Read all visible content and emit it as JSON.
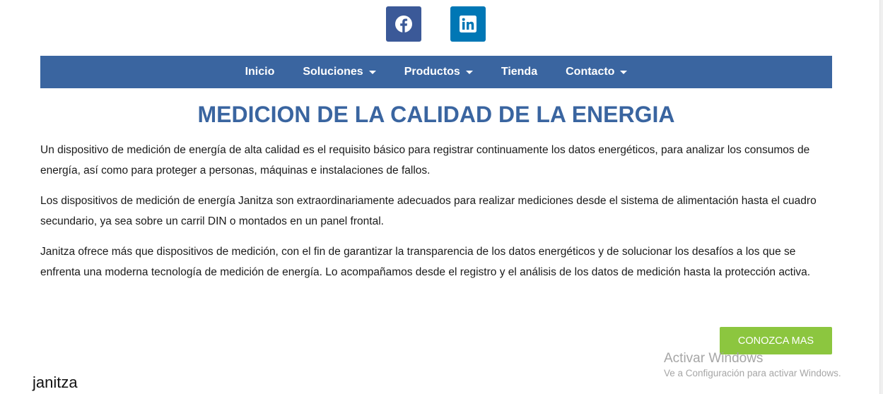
{
  "social": {
    "facebook_icon": "facebook-icon",
    "linkedin_icon": "linkedin-icon",
    "facebook_color": "#3b5998",
    "linkedin_color": "#0077b5"
  },
  "nav": {
    "background_color": "#3a65a0",
    "items": [
      {
        "label": "Inicio",
        "has_dropdown": false
      },
      {
        "label": "Soluciones",
        "has_dropdown": true
      },
      {
        "label": "Productos",
        "has_dropdown": true
      },
      {
        "label": "Tienda",
        "has_dropdown": false
      },
      {
        "label": "Contacto",
        "has_dropdown": true
      }
    ]
  },
  "main": {
    "title": "MEDICION DE LA CALIDAD DE LA ENERGIA",
    "title_color": "#3a65a0",
    "paragraphs": [
      "Un dispositivo de medición de energía de alta calidad es el requisito básico para registrar continuamente los datos energéticos, para analizar los consumos de energía, así como para proteger a personas, máquinas e instalaciones de fallos.",
      "Los dispositivos de medición de energía Janitza son extraordinariamente adecuados para realizar mediciones desde el sistema de alimentación hasta el cuadro secundario, ya sea sobre un carril DIN o montados en un panel frontal.",
      "Janitza ofrece más que dispositivos de medición, con el fin de garantizar la transparencia de los datos energéticos y de solucionar los desafíos a los que se enfrenta una moderna tecnología de medición de energía. Lo acompañamos desde el registro y el análisis de los datos de medición hasta la protección activa."
    ],
    "cta_label": "CONOZCA MAS",
    "cta_color": "#8cc63f"
  },
  "watermark": {
    "title": "Activar Windows",
    "subtitle": "Ve a Configuración para activar Windows."
  },
  "footer": {
    "brand": "janitza"
  }
}
